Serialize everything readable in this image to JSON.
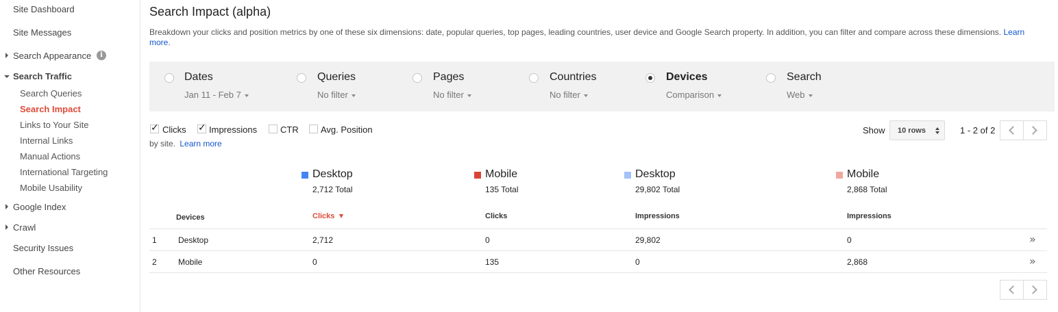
{
  "sidebar": {
    "site_dashboard": "Site Dashboard",
    "site_messages": "Site Messages",
    "search_appearance": "Search Appearance",
    "search_traffic": "Search Traffic",
    "search_traffic_items": [
      "Search Queries",
      "Search Impact",
      "Links to Your Site",
      "Internal Links",
      "Manual Actions",
      "International Targeting",
      "Mobile Usability"
    ],
    "google_index": "Google Index",
    "crawl": "Crawl",
    "security_issues": "Security Issues",
    "other_resources": "Other Resources",
    "info_glyph": "i"
  },
  "header": {
    "title": "Search Impact (alpha)",
    "description": "Breakdown your clicks and position metrics by one of these six dimensions: date, popular queries, top pages, leading countries, user device and Google Search property. In addition, you can filter and compare across these dimensions.",
    "learn_more": "Learn more."
  },
  "filters": [
    {
      "label": "Dates",
      "sub": "Jan 11 - Feb 7",
      "selected": false
    },
    {
      "label": "Queries",
      "sub": "No filter",
      "selected": false
    },
    {
      "label": "Pages",
      "sub": "No filter",
      "selected": false
    },
    {
      "label": "Countries",
      "sub": "No filter",
      "selected": false
    },
    {
      "label": "Devices",
      "sub": "Comparison",
      "selected": true
    },
    {
      "label": "Search",
      "sub": "Web",
      "selected": false
    }
  ],
  "metrics": [
    {
      "label": "Clicks",
      "checked": true
    },
    {
      "label": "Impressions",
      "checked": true
    },
    {
      "label": "CTR",
      "checked": false
    },
    {
      "label": "Avg. Position",
      "checked": false
    }
  ],
  "by_site": {
    "text": "by site.",
    "link": "Learn more"
  },
  "pagination": {
    "show_label": "Show",
    "rows": "10 rows",
    "range": "1 - 2 of 2"
  },
  "legend": [
    {
      "name": "Desktop",
      "total": "2,712 Total",
      "color": "#4285f4"
    },
    {
      "name": "Mobile",
      "total": "135 Total",
      "color": "#db4437"
    },
    {
      "name": "Desktop",
      "total": "29,802 Total",
      "color": "#a3c2f5"
    },
    {
      "name": "Mobile",
      "total": "2,868 Total",
      "color": "#f0a89e"
    }
  ],
  "table": {
    "headers": [
      "Devices",
      "Clicks",
      "Clicks",
      "Impressions",
      "Impressions"
    ],
    "rows": [
      {
        "index": "1",
        "device": "Desktop",
        "values": [
          "2,712",
          "0",
          "29,802",
          "0"
        ]
      },
      {
        "index": "2",
        "device": "Mobile",
        "values": [
          "0",
          "135",
          "0",
          "2,868"
        ]
      }
    ],
    "expand_glyph": "»"
  }
}
